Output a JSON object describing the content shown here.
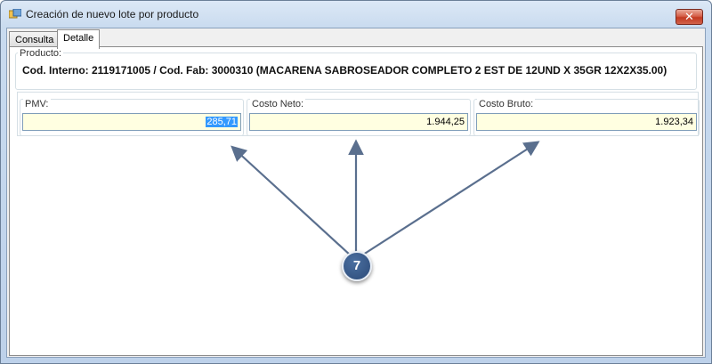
{
  "window": {
    "title": "Creación de nuevo lote por producto",
    "close_glyph": "✕"
  },
  "tabs": [
    {
      "label": "Consulta",
      "active": false
    },
    {
      "label": "Detalle",
      "active": true
    }
  ],
  "producto": {
    "label": "Producto:",
    "text": "Cod. Interno: 2119171005 / Cod. Fab: 3000310 (MACARENA SABROSEADOR COMPLETO  2 EST DE 12UND X 35GR 12X2X35.00)"
  },
  "fields": {
    "pmv": {
      "label": "PMV:",
      "value": "285,71"
    },
    "costo_neto": {
      "label": "Costo Neto:",
      "value": "1.944,25"
    },
    "costo_bruto": {
      "label": "Costo Bruto:",
      "value": "1.923,34"
    }
  },
  "callout": {
    "number": "7"
  },
  "icons": {
    "app": "app-window-icon",
    "close": "close-icon",
    "arrows": "callout-arrow-icon"
  },
  "colors": {
    "input_background": "#ffffe1",
    "selection": "#3399ff",
    "callout": "#2c4a78",
    "close_button": "#c23a22"
  }
}
